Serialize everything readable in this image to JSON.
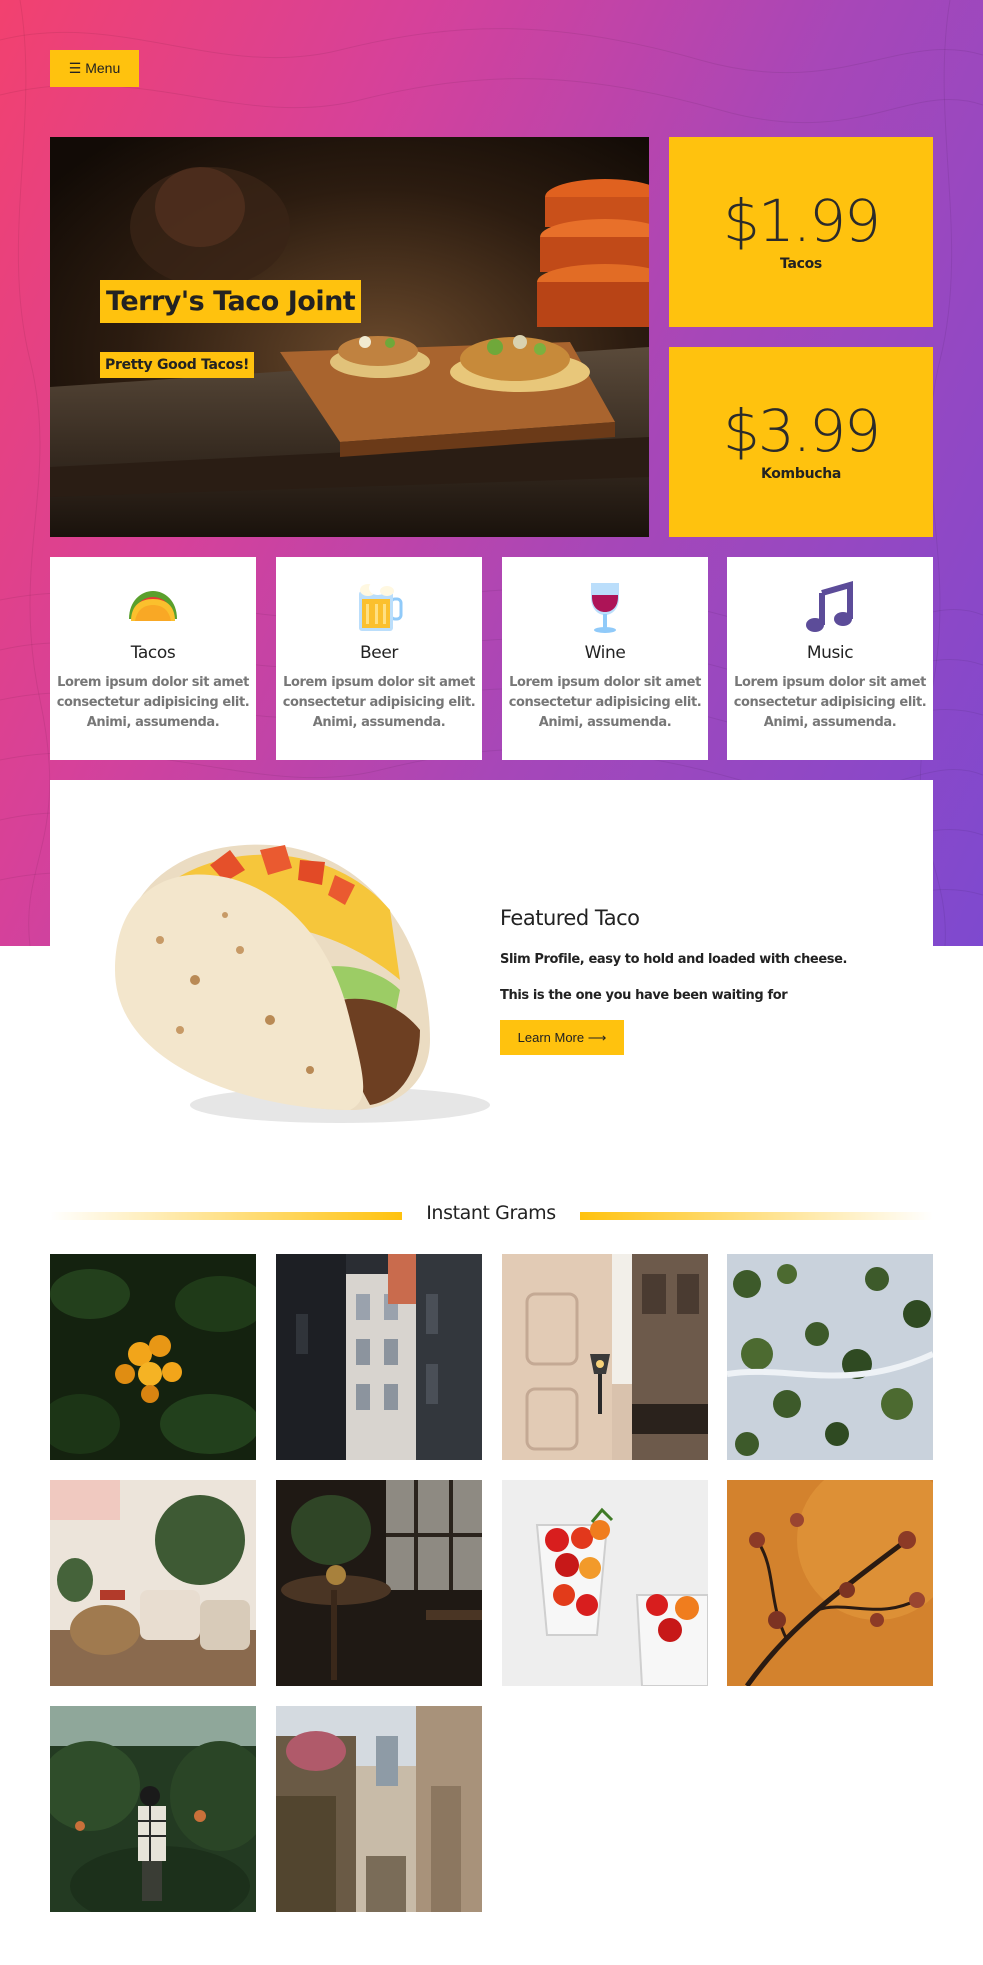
{
  "nav": {
    "menu_icon": "hamburger-icon",
    "menu_label": "☰ Menu"
  },
  "hero": {
    "title": "Terry's Taco Joint",
    "subtitle": "Pretty Good Tacos!"
  },
  "prices": [
    {
      "amount": "$1.99",
      "label": "Tacos"
    },
    {
      "amount": "$3.99",
      "label": "Kombucha"
    }
  ],
  "features": [
    {
      "icon": "taco-icon",
      "title": "Tacos",
      "desc": "Lorem ipsum dolor sit amet consectetur adipisicing elit. Animi, assumenda."
    },
    {
      "icon": "beer-mug-icon",
      "title": "Beer",
      "desc": "Lorem ipsum dolor sit amet consectetur adipisicing elit. Animi, assumenda."
    },
    {
      "icon": "wine-glass-icon",
      "title": "Wine",
      "desc": "Lorem ipsum dolor sit amet consectetur adipisicing elit. Animi, assumenda."
    },
    {
      "icon": "music-note-icon",
      "title": "Music",
      "desc": "Lorem ipsum dolor sit amet consectetur adipisicing elit. Animi, assumenda."
    }
  ],
  "featured": {
    "title": "Featured Taco",
    "line1": "Slim Profile, easy to hold and loaded with cheese.",
    "line2": "This is the one you have been waiting for",
    "button_label": "Learn More ⟶"
  },
  "grams": {
    "title": "Instant Grams",
    "photos": [
      "yellow-flowers-photo",
      "narrow-street-photo",
      "building-lamp-photo",
      "snowy-forest-aerial-photo",
      "living-room-photo",
      "cafe-interior-photo",
      "tomato-glasses-photo",
      "blossom-branch-photo",
      "man-in-garden-photo",
      "old-alley-photo"
    ]
  },
  "colors": {
    "accent": "#ffc20e",
    "gradient_start": "#f2416f",
    "gradient_end": "#7e49cf"
  }
}
